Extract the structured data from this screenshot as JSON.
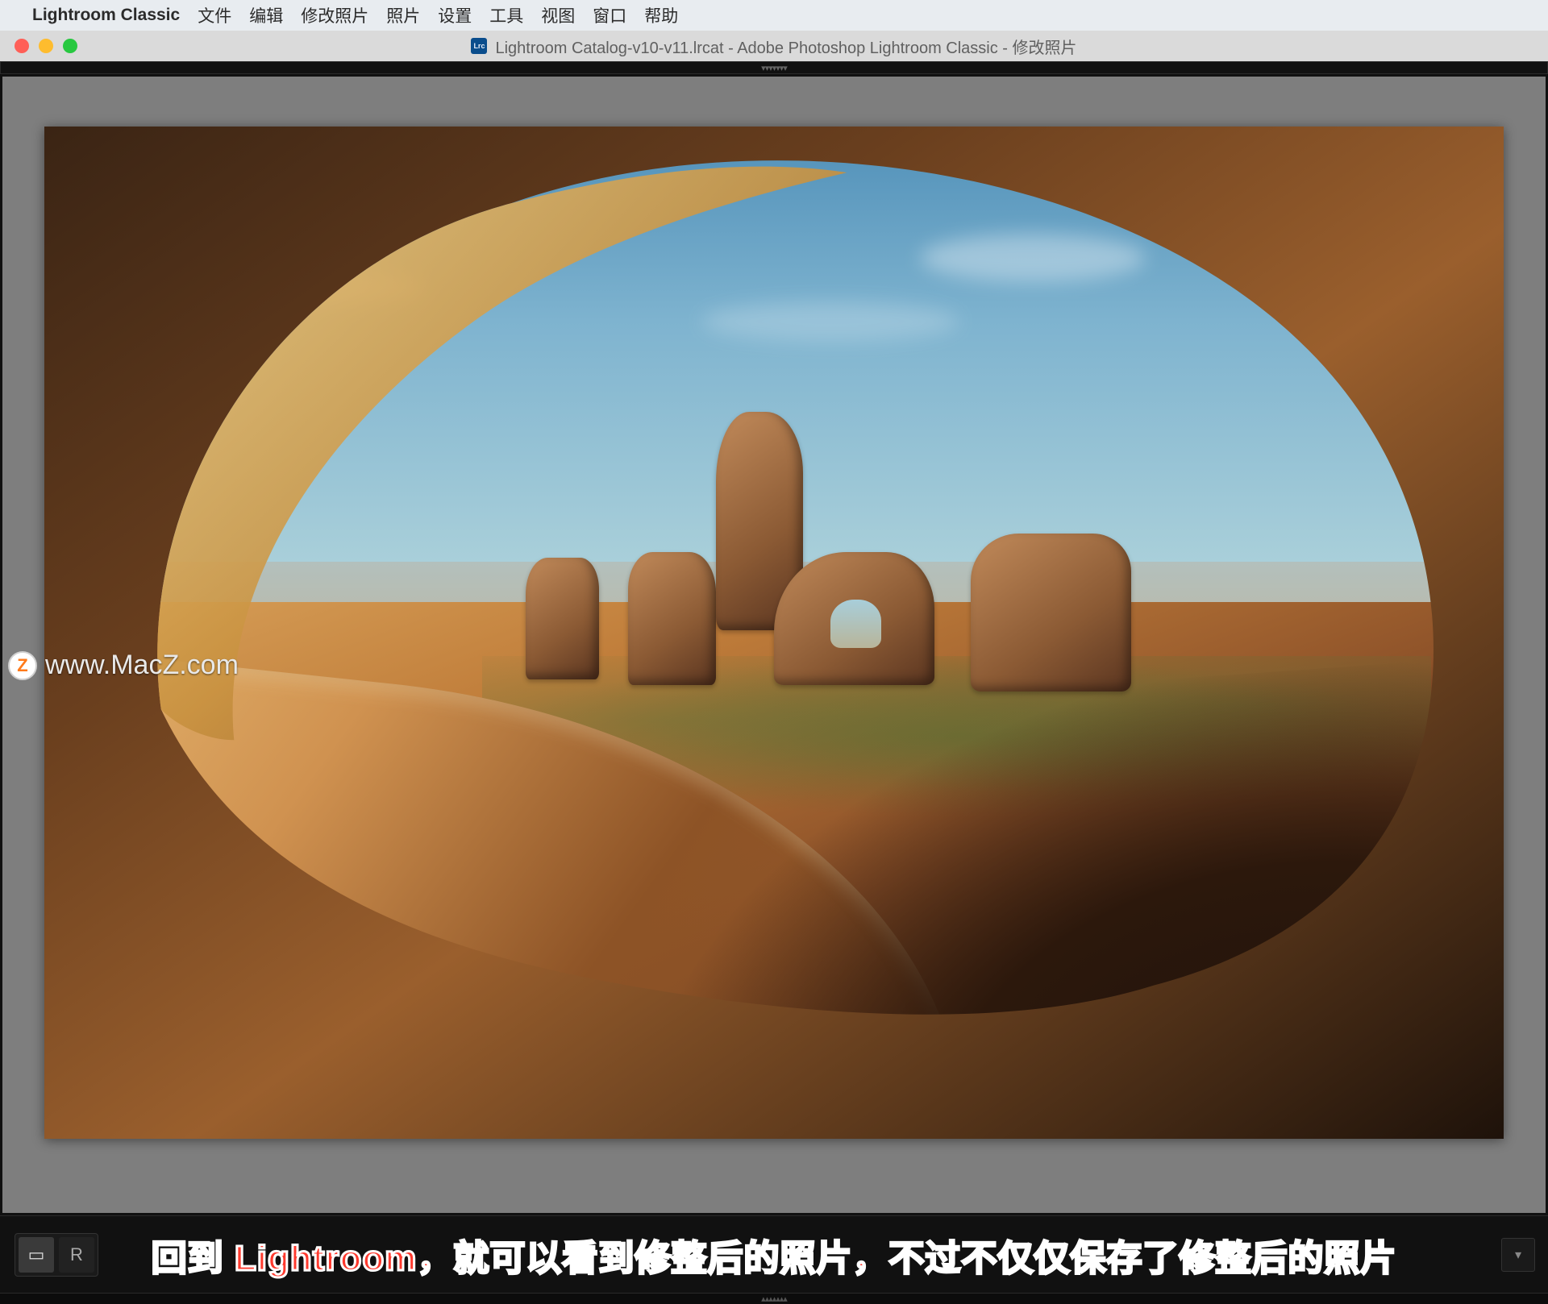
{
  "menubar": {
    "app_name": "Lightroom Classic",
    "items": [
      "文件",
      "编辑",
      "修改照片",
      "照片",
      "设置",
      "工具",
      "视图",
      "窗口",
      "帮助"
    ]
  },
  "window": {
    "title": "Lightroom Catalog-v10-v11.lrcat - Adobe Photoshop Lightroom Classic - 修改照片",
    "app_icon_text": "Lrc"
  },
  "watermark": {
    "badge": "Z",
    "text": "www.MacZ.com"
  },
  "toolbar": {
    "view_grid": "▭",
    "r_label": "R"
  },
  "caption": "回到 Lightroom，就可以看到修整后的照片，不过不仅仅保存了修整后的照片",
  "colors": {
    "sky_top": "#4f8fb8",
    "sky_bottom": "#b2d5dc",
    "rock_light": "#d9a25a",
    "rock_dark": "#2c180c",
    "caption_fill": "#ff3a2e",
    "caption_stroke": "#ffffff"
  }
}
